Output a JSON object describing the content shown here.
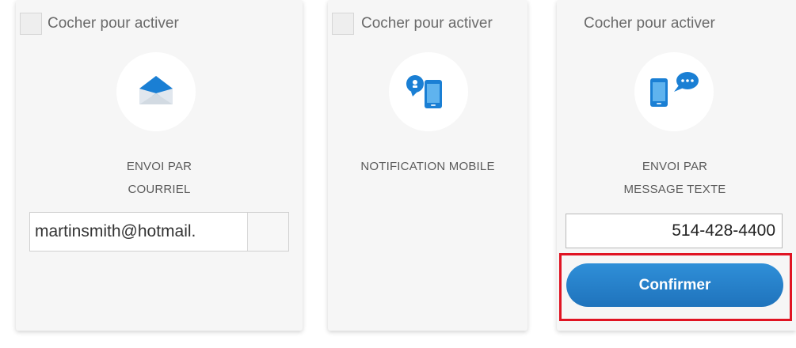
{
  "cards": [
    {
      "toggle_label": "Cocher pour activer",
      "icon": "envelope-icon",
      "title_line1": "ENVOI PAR",
      "title_line2": "COURRIEL",
      "email_value": "martinsmith@hotmail."
    },
    {
      "toggle_label": "Cocher pour activer",
      "icon": "mobile-notification-icon",
      "title_line1": "NOTIFICATION MOBILE"
    },
    {
      "toggle_label": "Cocher pour activer",
      "icon": "text-message-icon",
      "title_line1": "ENVOI PAR",
      "title_line2": "MESSAGE TEXTE",
      "phone_value": "514-428-4400",
      "confirm_label": "Confirmer"
    }
  ],
  "colors": {
    "accent_blue": "#1f73bc",
    "icon_blue": "#1a7fd4",
    "highlight_red": "#e01423",
    "card_bg": "#f6f6f6"
  }
}
